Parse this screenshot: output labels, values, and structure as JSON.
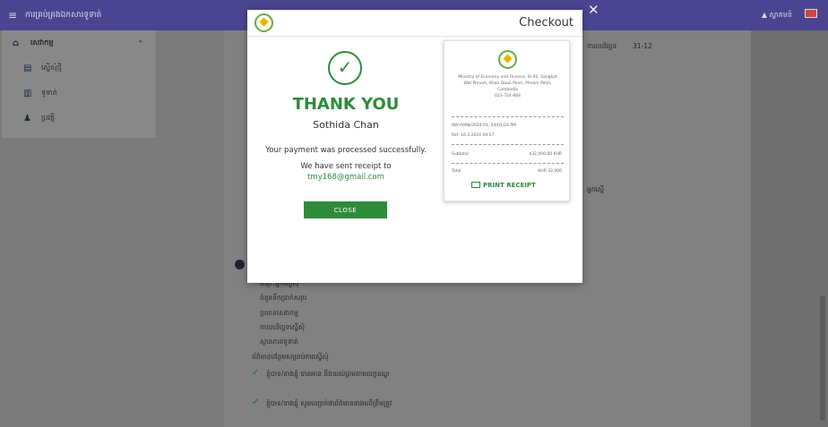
{
  "topbar": {
    "menu_icon": "≡",
    "title": "ការគ្រប់គ្រងឯកសារទូទាត់",
    "user": "ស្វាគមន៍",
    "menu_icon_name": "hamburger-icon",
    "user_icon_name": "user-icon",
    "flag_icon_name": "uk-flag-icon"
  },
  "sidebar": {
    "items": [
      {
        "label": "សេវាកម្ម",
        "icon": "⌂",
        "chevron": "⌃"
      },
      {
        "label": "ស្នើសុំថ្មី",
        "icon": "▤"
      },
      {
        "label": "ទូទាត់",
        "icon": "▥"
      },
      {
        "label": "ប្រវត្តិ",
        "icon": "♟"
      }
    ]
  },
  "background": {
    "date_label": "កាលបរិច្ឆេទ",
    "date_value": "31-12",
    "side_label": "អ្នកស្នើ",
    "lines": [
      "ឈ្មោះអ្នកស្នើសុំ",
      "ចំនួនទឹកប្រាក់សរុប",
      "ប្រភេទសេវាកម្ម",
      "កាលបរិច្ឆេទស្នើសុំ",
      "ស្ថានភាពទូទាត់",
      "ព័ត៌មានបន្ថែមសម្រាប់ការស្នើសុំ"
    ],
    "check_items": [
      "ខ្ញុំបាទ/នាងខ្ញុំ បានអាន និងយល់ព្រមតាមលក្ខខណ្ឌ",
      "ខ្ញុំបាទ/នាងខ្ញុំ សូមបញ្ជាក់ថាព័ត៌មានខាងលើត្រឹមត្រូវ"
    ],
    "check_icon": "✓"
  },
  "modal": {
    "title": "Checkout",
    "close_icon": "✕",
    "success_icon": "✓",
    "thank_you": "THANK YOU",
    "customer_name": "Sothida Chan",
    "message_line1": "Your payment was processed successfully.",
    "message_line2": "We have sent receipt to",
    "email": "tmy168@gmail.com",
    "close_button": "CLOSE"
  },
  "receipt": {
    "org_line1": "Ministry of Economy and Finance, St.92, Sangkat",
    "org_line2": "Wat Phnom, Khan Daun Penh, Phnom Penh,",
    "org_line3": "Cambodia",
    "org_line4": "023-724-664",
    "ref_line": "INV-0098/2024-01, 24/01/24 PM",
    "meta_line": "Ref: 10.3.2024 09:57",
    "subtotal_label": "Subtotal",
    "subtotal_value": "$32,000.00 KHR",
    "total_label": "Total",
    "total_value": "KHR 32,000",
    "print_label": "PRINT RECEIPT"
  }
}
